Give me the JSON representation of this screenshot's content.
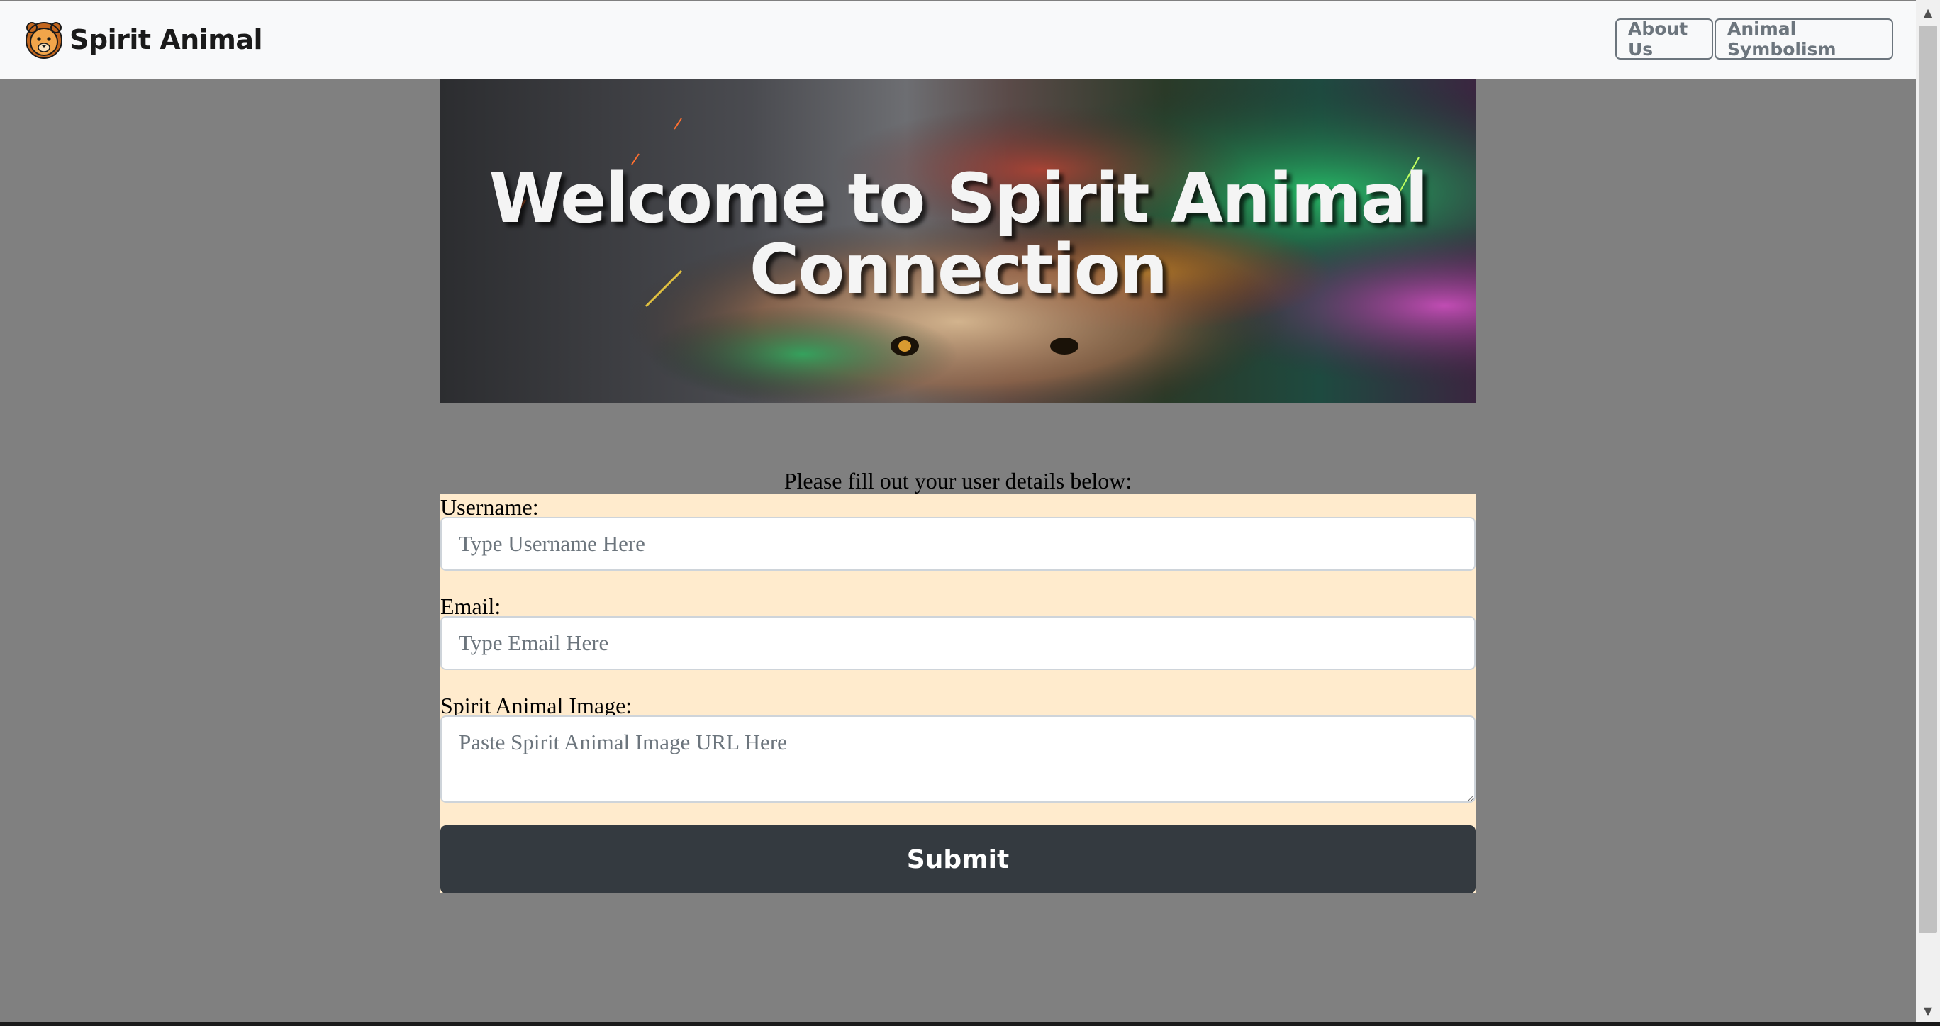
{
  "navbar": {
    "brand_name": "Spirit Animal",
    "logo_icon": "lion-face-icon",
    "buttons": [
      {
        "label": "About Us"
      },
      {
        "label": "Animal Symbolism"
      }
    ]
  },
  "hero": {
    "title": "Welcome to Spirit Animal Connection"
  },
  "form": {
    "prompt": "Please fill out your user details below:",
    "username": {
      "label": "Username:",
      "placeholder": "Type Username Here",
      "value": ""
    },
    "email": {
      "label": "Email:",
      "placeholder": "Type Email Here",
      "value": ""
    },
    "image": {
      "label": "Spirit Animal Image:",
      "placeholder": "Paste Spirit Animal Image URL Here",
      "value": ""
    },
    "submit_label": "Submit"
  },
  "colors": {
    "page_background": "#808080",
    "navbar_background": "#f8f9fa",
    "form_background": "#ffebcd",
    "submit_background": "#343a40",
    "nav_button_text": "#6c757d"
  }
}
